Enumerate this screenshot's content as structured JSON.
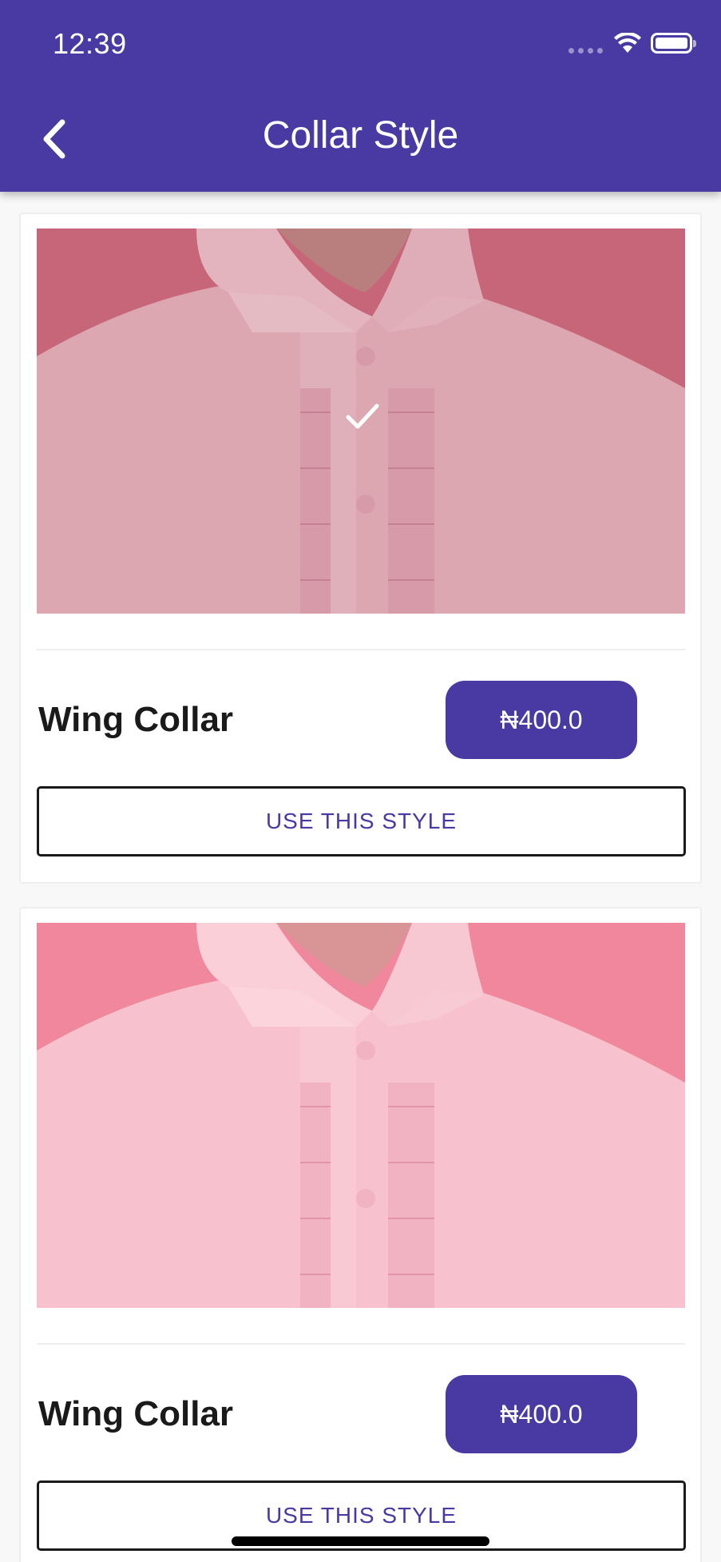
{
  "status_bar": {
    "time": "12:39"
  },
  "header": {
    "title": "Collar Style"
  },
  "styles": [
    {
      "name": "Wing Collar",
      "price": "₦400.0",
      "button_label": "USE THIS STYLE",
      "selected": true,
      "image_tone": "#d96f84"
    },
    {
      "name": "Wing Collar",
      "price": "₦400.0",
      "button_label": "USE THIS STYLE",
      "selected": false,
      "image_tone": "#f0879c"
    }
  ],
  "colors": {
    "primary": "#4839a3",
    "background": "#f8f8f8",
    "text": "#1a1a1a"
  }
}
